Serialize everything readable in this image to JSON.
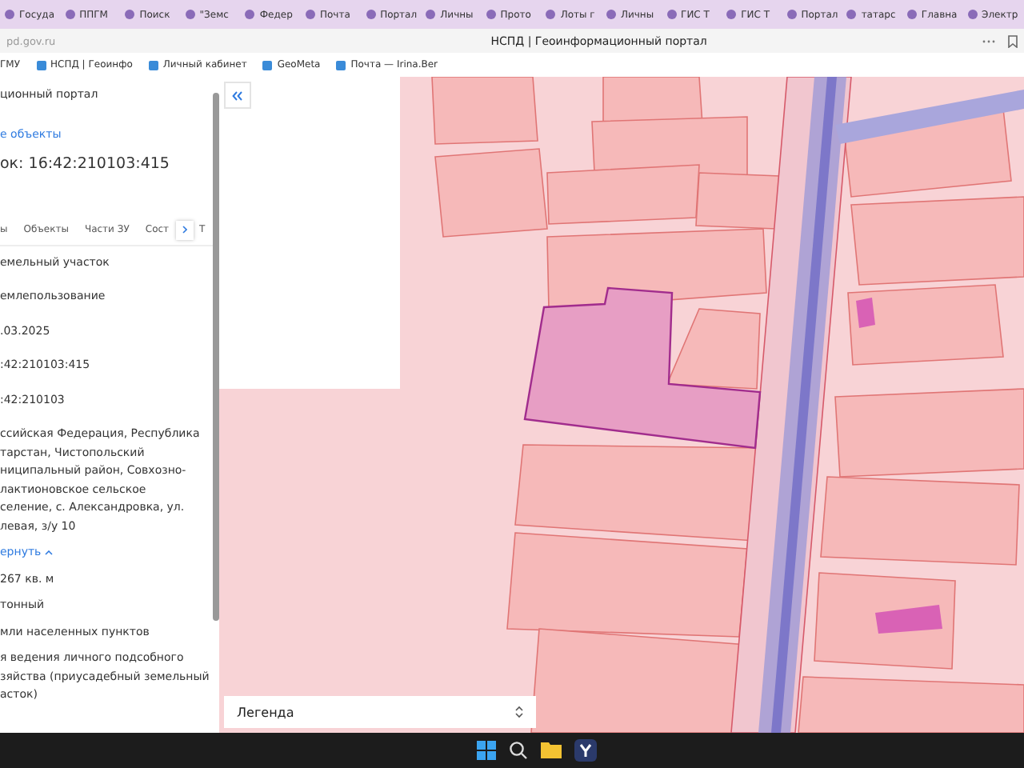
{
  "browser": {
    "tabs": [
      {
        "label": "Госуда",
        "selected": false
      },
      {
        "label": "ППГМ",
        "selected": false
      },
      {
        "label": "Поиск",
        "selected": false
      },
      {
        "label": "\"Земс",
        "selected": false
      },
      {
        "label": "Федер",
        "selected": false
      },
      {
        "label": "Почта",
        "selected": false
      },
      {
        "label": "Портал",
        "selected": false
      },
      {
        "label": "Личны",
        "selected": false
      },
      {
        "label": "Прото",
        "selected": false
      },
      {
        "label": "Лоты г",
        "selected": false
      },
      {
        "label": "Личны",
        "selected": false
      },
      {
        "label": "ГИС Т",
        "selected": false
      },
      {
        "label": "ГИС Т",
        "selected": false
      },
      {
        "label": "Портал",
        "selected": false
      },
      {
        "label": "татарс",
        "selected": false
      },
      {
        "label": "Главна",
        "selected": false
      },
      {
        "label": "Электр",
        "selected": false
      }
    ],
    "address": "pd.gov.ru",
    "page_title": "НСПД | Геоинформационный портал",
    "bookmarks": [
      "ГМУ",
      "НСПД | Геоинфо",
      "Личный кабинет",
      "GeoMeta",
      "Почта — Irina.Ber"
    ]
  },
  "panel": {
    "portal_title": "ционный портал",
    "back_link": "е объекты",
    "heading": "ок: 16:42:210103:415",
    "tabs": [
      {
        "label": "ы",
        "selected": false
      },
      {
        "label": "Объекты",
        "selected": false
      },
      {
        "label": "Части ЗУ",
        "selected": false
      },
      {
        "label": "Сост",
        "selected": false
      },
      {
        "label": "Т",
        "selected": false
      }
    ],
    "fields": [
      {
        "kind": "text",
        "value": "емельный участок"
      },
      {
        "kind": "text",
        "value": "емлепользование"
      },
      {
        "kind": "text",
        "value": ".03.2025"
      },
      {
        "kind": "text",
        "value": ":42:210103:415"
      },
      {
        "kind": "text",
        "value": ":42:210103"
      },
      {
        "kind": "text",
        "value": "ссийская Федерация, Республика\nтарстан, Чистопольский\nниципальный район, Совхозно-\nлактионовское сельское\nселение, с. Александровка, ул.\nлевая, з/у 10"
      },
      {
        "kind": "link",
        "value": "ернуть"
      },
      {
        "kind": "text",
        "value": "267 кв. м"
      },
      {
        "kind": "text",
        "value": "тонный"
      },
      {
        "kind": "text",
        "value": "мли населенных пунктов"
      },
      {
        "kind": "text",
        "value": "я ведения личного подсобного\nзяйства (приусадебный земельный\nасток)"
      }
    ]
  },
  "map": {
    "legend": "Легенда"
  }
}
